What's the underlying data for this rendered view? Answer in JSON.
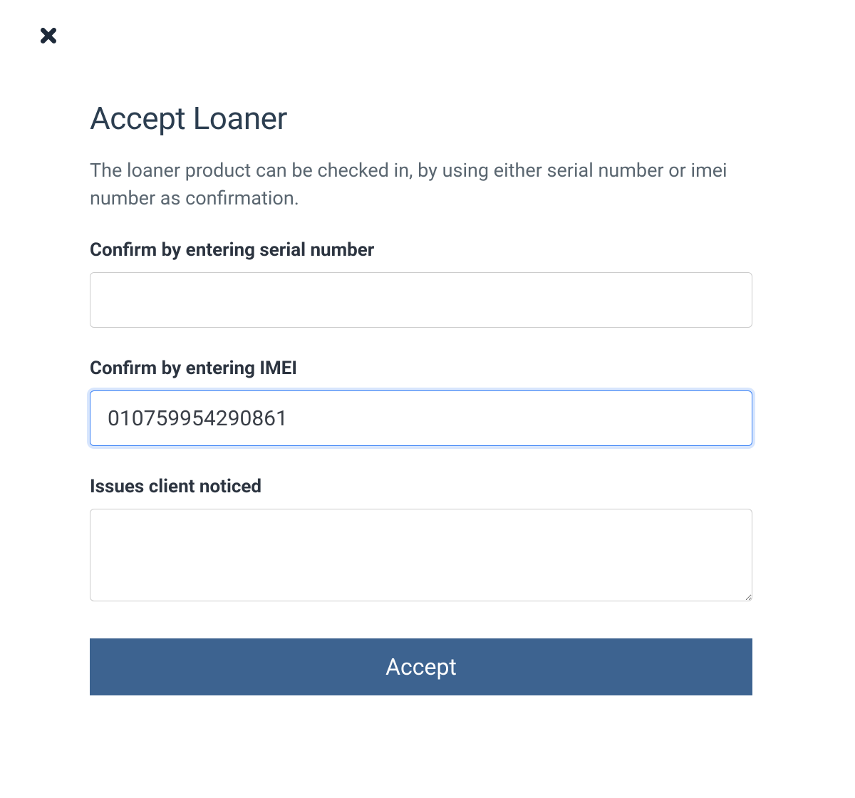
{
  "dialog": {
    "title": "Accept Loaner",
    "description": "The loaner product can be checked in, by using either serial number or imei number as confirmation."
  },
  "form": {
    "serial": {
      "label": "Confirm by entering serial number",
      "value": ""
    },
    "imei": {
      "label": "Confirm by entering IMEI",
      "value": "010759954290861"
    },
    "issues": {
      "label": "Issues client noticed",
      "value": ""
    }
  },
  "buttons": {
    "accept": "Accept"
  }
}
